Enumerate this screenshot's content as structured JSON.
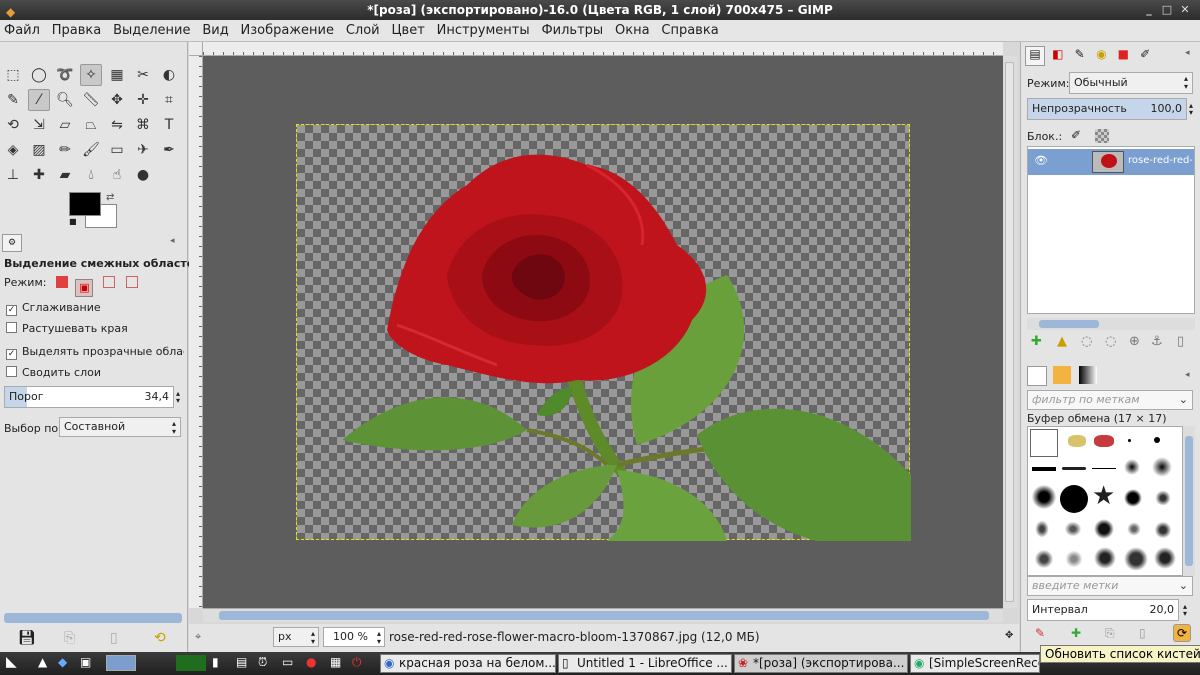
{
  "window": {
    "title": "*[роза] (экспортировано)-16.0 (Цвета RGB, 1 слой) 700x475 – GIMP"
  },
  "menu": [
    "Файл",
    "Правка",
    "Выделение",
    "Вид",
    "Изображение",
    "Слой",
    "Цвет",
    "Инструменты",
    "Фильтры",
    "Окна",
    "Справка"
  ],
  "tool_options": {
    "title": "Выделение смежных областей",
    "mode_label": "Режим:",
    "antialias": "Сглаживание",
    "feather": "Растушевать края",
    "select_transparent": "Выделять прозрачные области",
    "sample_merged": "Сводить слои",
    "threshold_label": "Порог",
    "threshold_value": "34,4",
    "select_by_label": "Выбор по:",
    "select_by_value": "Составной"
  },
  "status": {
    "unit": "px",
    "zoom": "100 %",
    "filename": "rose-red-red-rose-flower-macro-bloom-1370867.jpg (12,0 МБ)"
  },
  "layers": {
    "mode_label": "Режим:",
    "mode_value": "Обычный",
    "opacity_label": "Непрозрачность",
    "opacity_value": "100,0",
    "lock_label": "Блок.:",
    "layer_name": "rose-red-red-rose"
  },
  "brushes": {
    "filter_placeholder": "фильтр по меткам",
    "title": "Буфер обмена (17 × 17)",
    "tags_placeholder": "введите метки",
    "spacing_label": "Интервал",
    "spacing_value": "20,0",
    "tooltip": "Обновить список кистей"
  },
  "taskbar": [
    {
      "label": "красная роза на белом..."
    },
    {
      "label": "Untitled 1 - LibreOffice ..."
    },
    {
      "label": "*[роза] (экспортирова..."
    },
    {
      "label": "[SimpleScreenRecorder]"
    }
  ]
}
